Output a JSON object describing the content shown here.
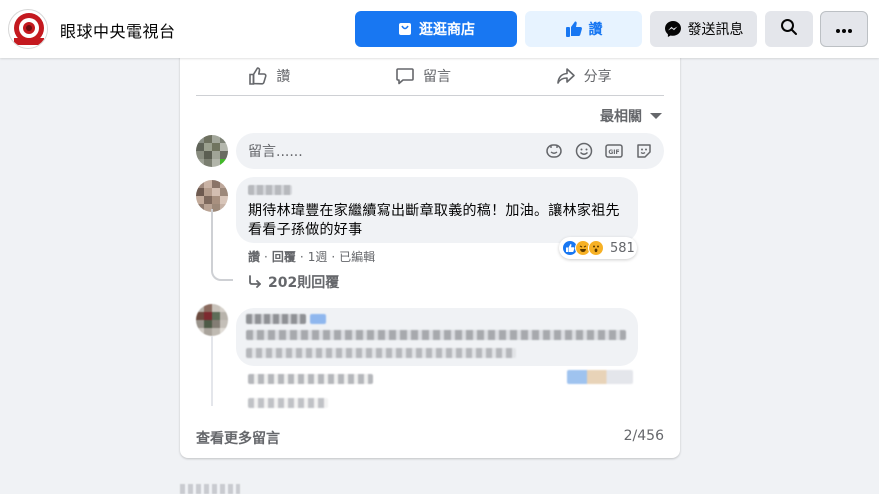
{
  "header": {
    "page_name": "眼球中央電視台",
    "logo_text": "EYECTV",
    "shop_label": "逛逛商店",
    "like_label": "讚",
    "message_label": "發送訊息",
    "search_icon": "search-icon",
    "more_icon": "more-icon",
    "colors": {
      "primary": "#1877f2",
      "like_bg": "#e7f3ff",
      "secondary_bg": "#e4e6eb"
    }
  },
  "post_actions": {
    "like": "讚",
    "comment": "留言",
    "share": "分享"
  },
  "sort": {
    "label": "最相關"
  },
  "composer": {
    "placeholder": "留言......",
    "icons": [
      "sticker-icon",
      "emoji-icon",
      "gif-icon",
      "sticker-face-icon"
    ]
  },
  "comments": [
    {
      "text": "期待林瑋豐在家繼續寫出斷章取義的稿！加油。讓林家祖先看看子孫做的好事",
      "reaction_count": "581",
      "reactions": [
        "like",
        "haha",
        "wow"
      ],
      "meta": {
        "like": "讚",
        "reply": "回覆",
        "time": "1週",
        "edited": "已編輯"
      },
      "replies_label": "202則回覆"
    }
  ],
  "footer": {
    "view_more": "查看更多留言",
    "count": "2/456"
  }
}
